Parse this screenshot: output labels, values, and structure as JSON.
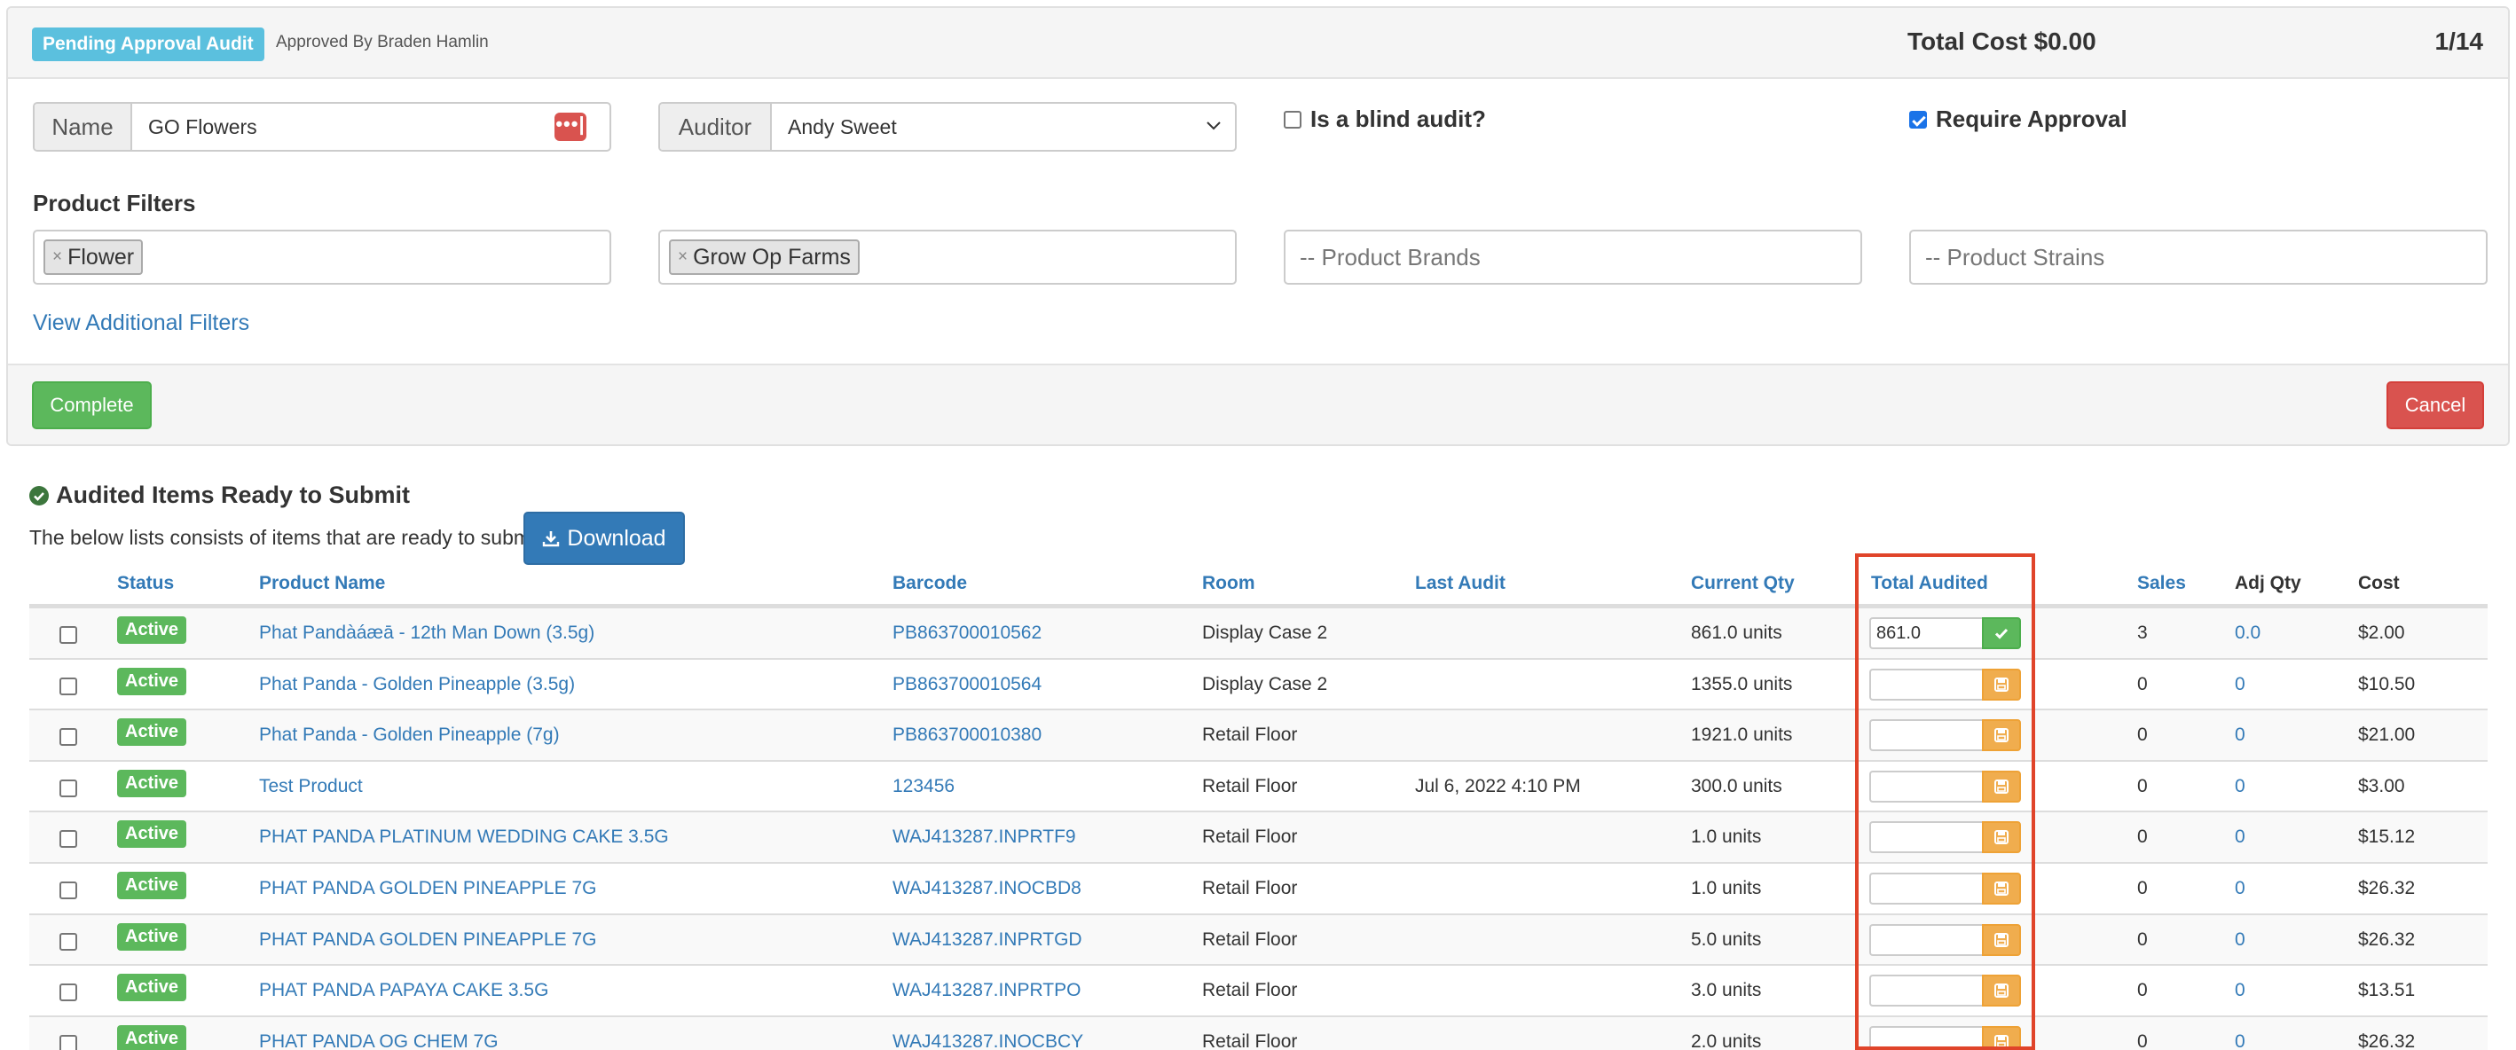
{
  "header": {
    "status_badge": "Pending Approval Audit",
    "approved_by": "Approved By Braden Hamlin",
    "total_cost": "Total Cost $0.00",
    "page_counter": "1/14"
  },
  "form": {
    "name_label": "Name",
    "name_value": "GO Flowers",
    "auditor_label": "Auditor",
    "auditor_value": "Andy Sweet",
    "blind_audit_label": "Is a blind audit?",
    "blind_audit_checked": false,
    "require_approval_label": "Require Approval",
    "require_approval_checked": true
  },
  "filters": {
    "title": "Product Filters",
    "category_tag": "Flower",
    "vendor_tag": "Grow Op Farms",
    "brands_placeholder": "-- Product Brands",
    "strains_placeholder": "-- Product Strains",
    "additional_link": "View Additional Filters"
  },
  "actions": {
    "complete": "Complete",
    "cancel": "Cancel"
  },
  "colors": {
    "info": "#5bc0de",
    "success": "#5cb85c",
    "danger": "#d9534f",
    "warning": "#f0ad4e",
    "primary": "#337ab7",
    "highlight": "#e0442a"
  },
  "items": {
    "title": "Audited Items Ready to Submit",
    "description": "The below lists consists of items that are ready to submit.",
    "download_label": "Download",
    "columns": {
      "status": "Status",
      "product_name": "Product Name",
      "barcode": "Barcode",
      "room": "Room",
      "last_audit": "Last Audit",
      "current_qty": "Current Qty",
      "total_audited": "Total Audited",
      "sales": "Sales",
      "adj_qty": "Adj Qty",
      "cost": "Cost"
    },
    "rows": [
      {
        "status": "Active",
        "product_name": "Phat Pandàáæā - 12th Man Down (3.5g)",
        "barcode": "PB863700010562",
        "room": "Display Case 2",
        "last_audit": "",
        "current_qty": "861.0 units",
        "audited": "861.0",
        "saved": true,
        "sales": "3",
        "adj_qty": "0.0",
        "cost": "$2.00"
      },
      {
        "status": "Active",
        "product_name": "Phat Panda - Golden Pineapple (3.5g)",
        "barcode": "PB863700010564",
        "room": "Display Case 2",
        "last_audit": "",
        "current_qty": "1355.0 units",
        "audited": "",
        "saved": false,
        "sales": "0",
        "adj_qty": "0",
        "cost": "$10.50"
      },
      {
        "status": "Active",
        "product_name": "Phat Panda - Golden Pineapple (7g)",
        "barcode": "PB863700010380",
        "room": "Retail Floor",
        "last_audit": "",
        "current_qty": "1921.0 units",
        "audited": "",
        "saved": false,
        "sales": "0",
        "adj_qty": "0",
        "cost": "$21.00"
      },
      {
        "status": "Active",
        "product_name": "Test Product",
        "barcode": "123456",
        "room": "Retail Floor",
        "last_audit": "Jul 6, 2022 4:10 PM",
        "current_qty": "300.0 units",
        "audited": "",
        "saved": false,
        "sales": "0",
        "adj_qty": "0",
        "cost": "$3.00"
      },
      {
        "status": "Active",
        "product_name": "PHAT PANDA PLATINUM WEDDING CAKE 3.5G",
        "barcode": "WAJ413287.INPRTF9",
        "room": "Retail Floor",
        "last_audit": "",
        "current_qty": "1.0 units",
        "audited": "",
        "saved": false,
        "sales": "0",
        "adj_qty": "0",
        "cost": "$15.12"
      },
      {
        "status": "Active",
        "product_name": "PHAT PANDA GOLDEN PINEAPPLE 7G",
        "barcode": "WAJ413287.INOCBD8",
        "room": "Retail Floor",
        "last_audit": "",
        "current_qty": "1.0 units",
        "audited": "",
        "saved": false,
        "sales": "0",
        "adj_qty": "0",
        "cost": "$26.32"
      },
      {
        "status": "Active",
        "product_name": "PHAT PANDA GOLDEN PINEAPPLE 7G",
        "barcode": "WAJ413287.INPRTGD",
        "room": "Retail Floor",
        "last_audit": "",
        "current_qty": "5.0 units",
        "audited": "",
        "saved": false,
        "sales": "0",
        "adj_qty": "0",
        "cost": "$26.32"
      },
      {
        "status": "Active",
        "product_name": "PHAT PANDA PAPAYA CAKE 3.5G",
        "barcode": "WAJ413287.INPRTPO",
        "room": "Retail Floor",
        "last_audit": "",
        "current_qty": "3.0 units",
        "audited": "",
        "saved": false,
        "sales": "0",
        "adj_qty": "0",
        "cost": "$13.51"
      },
      {
        "status": "Active",
        "product_name": "PHAT PANDA OG CHEM 7G",
        "barcode": "WAJ413287.INOCBCY",
        "room": "Retail Floor",
        "last_audit": "",
        "current_qty": "2.0 units",
        "audited": "",
        "saved": false,
        "sales": "0",
        "adj_qty": "0",
        "cost": "$26.32"
      }
    ]
  }
}
